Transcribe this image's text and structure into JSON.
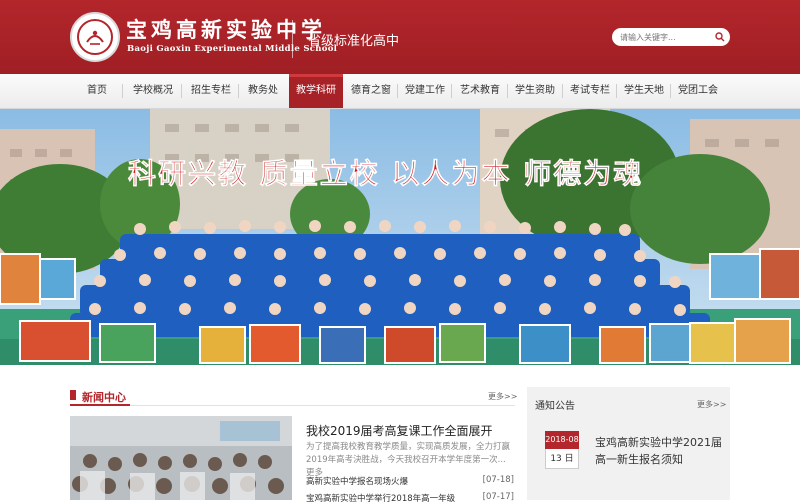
{
  "header": {
    "school_name_cn": "宝鸡高新实验中学",
    "school_name_en": "Baoji Gaoxin Experimental Middle School",
    "tagline": "省级标准化高中",
    "search_placeholder": "请输入关键字..."
  },
  "nav": {
    "items": [
      {
        "label": "首页"
      },
      {
        "label": "学校概况"
      },
      {
        "label": "招生专栏"
      },
      {
        "label": "教务处"
      },
      {
        "label": "教学科研"
      },
      {
        "label": "德育之窗"
      },
      {
        "label": "党建工作"
      },
      {
        "label": "艺术教育"
      },
      {
        "label": "学生资助"
      },
      {
        "label": "考试专栏"
      },
      {
        "label": "学生天地"
      },
      {
        "label": "党团工会"
      }
    ],
    "active_index": 4
  },
  "banner": {
    "slogan": "科研兴教 质量立校 以人为本 师德为魂"
  },
  "news": {
    "title": "新闻中心",
    "more": "更多>>",
    "headline": "我校2019届考高复课工作全面展开",
    "summary": "为了提高我校教育教学质量，实现高质发展，全力打赢2019年高考決胜战，今天我校召开本学年度第一次...更多",
    "items": [
      {
        "title": "高新实验中学报名现场火爆",
        "date": "[07-18]"
      },
      {
        "title": "宝鸡高新实验中学举行2018年高一年级",
        "date": "[07-17]"
      }
    ]
  },
  "notice": {
    "title": "通知公告",
    "more": "更多>>",
    "date_ym": "2018-08",
    "date_day": "13 日",
    "item_title": "宝鸡高新实验中学2021届高一新生报名须知"
  },
  "colors": {
    "brand_red": "#b3262b",
    "nav_active": "#a72227"
  }
}
